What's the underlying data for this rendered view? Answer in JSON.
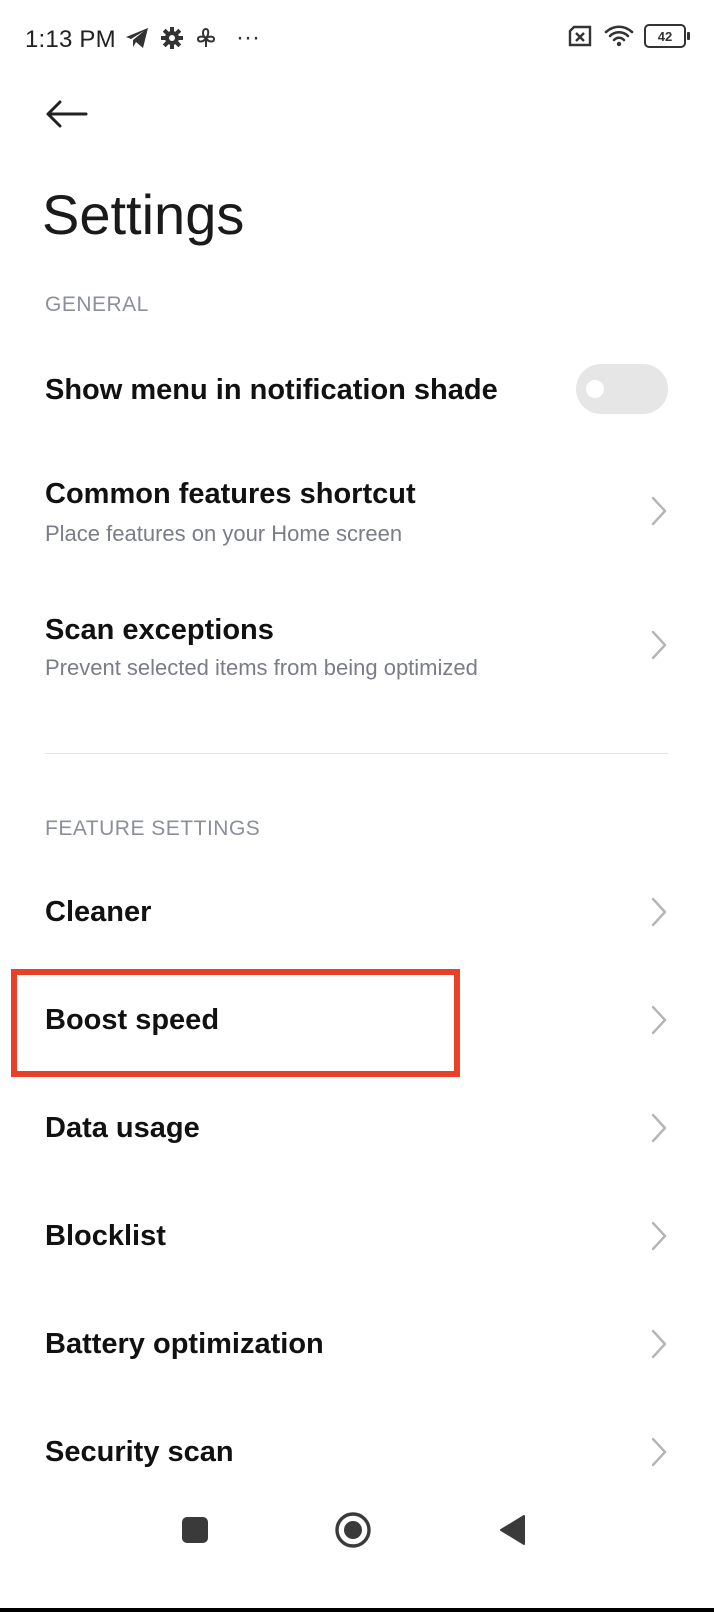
{
  "status_bar": {
    "time": "1:13 PM",
    "left_icons": [
      "telegram-icon",
      "gear-icon",
      "fan-icon",
      "more-dots-icon"
    ],
    "more_dots": "···",
    "right_icons": [
      "sim-x-icon",
      "wifi-icon",
      "battery-icon"
    ],
    "battery_level": "42"
  },
  "header": {
    "back_icon": "arrow-left-icon",
    "title": "Settings"
  },
  "sections": {
    "general": {
      "header": "GENERAL",
      "items": [
        {
          "title": "Show menu in notification shade",
          "control": "toggle",
          "enabled": false
        },
        {
          "title": "Common features shortcut",
          "subtitle": "Place features on your Home screen",
          "control": "chevron"
        },
        {
          "title": "Scan exceptions",
          "subtitle": "Prevent selected items from being optimized",
          "control": "chevron"
        }
      ]
    },
    "feature": {
      "header": "FEATURE SETTINGS",
      "items": [
        {
          "title": "Cleaner"
        },
        {
          "title": "Boost speed"
        },
        {
          "title": "Data usage"
        },
        {
          "title": "Blocklist"
        },
        {
          "title": "Battery optimization"
        },
        {
          "title": "Security scan"
        }
      ]
    }
  },
  "nav_bar": {
    "buttons": [
      "recents-square-icon",
      "home-circle-icon",
      "back-triangle-icon"
    ]
  },
  "colors": {
    "highlight": "#e8402a",
    "section_header": "#8b8f9a",
    "subtitle": "#7a7d85",
    "toggle_off": "#e6e6e6"
  }
}
